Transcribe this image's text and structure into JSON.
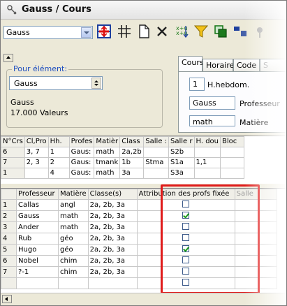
{
  "window": {
    "title": "Gauss / Cours"
  },
  "toolbar": {
    "combo_value": "Gauss",
    "icons": [
      "grid-icon",
      "hash-icon",
      "new-document-icon",
      "delete-icon",
      "sort-icon",
      "filter-icon",
      "copy-icon",
      "layout-icon"
    ]
  },
  "element_panel": {
    "group_label": "Pour élément:",
    "field_value": "Gauss",
    "name_text": "Gauss",
    "value_text": "17.000 Valeurs"
  },
  "tabs": {
    "items": [
      {
        "label": "Cours",
        "active": true
      },
      {
        "label": "Horaire",
        "active": false
      },
      {
        "label": "Code",
        "active": false
      },
      {
        "label": "S",
        "active": false
      }
    ],
    "fields": {
      "hebdo_value": "1",
      "hebdo_label": "H.hebdom.",
      "prof_value": "Gauss",
      "prof_label": "Professeur",
      "matiere_value": "math",
      "matiere_label": "Matière"
    }
  },
  "courses_grid": {
    "headers": [
      "N°Crs",
      "Cl,Pro",
      "Hh.",
      "Profes",
      "Matièr",
      "Class",
      "Salle :",
      "Salle r",
      "H. dou",
      "Bloc"
    ],
    "rows": [
      [
        "6",
        "3, 7",
        "1",
        "Gaus:",
        "math",
        "2a,2b",
        "",
        "S2b",
        "",
        ""
      ],
      [
        "7",
        "2, 3",
        "2",
        "Gaus:",
        "tmank",
        "1b",
        "Stma",
        "S1a",
        "1,1",
        ""
      ],
      [
        "1",
        "",
        "4",
        "Gaus:",
        "math",
        "3a",
        "",
        "S3a",
        "",
        ""
      ]
    ]
  },
  "assignment_grid": {
    "headers": [
      "",
      "Professeur",
      "Matière",
      "Classe(s)",
      "Attribution des profs fixée",
      "Salle"
    ],
    "rows": [
      {
        "num": "1",
        "prof": "Callas",
        "matiere": "angl",
        "classes": "2a, 2b, 3a",
        "fixed": false
      },
      {
        "num": "2",
        "prof": "Gauss",
        "matiere": "math",
        "classes": "2a, 2b, 3a",
        "fixed": true
      },
      {
        "num": "3",
        "prof": "Ander",
        "matiere": "math",
        "classes": "2a, 2b, 3a",
        "fixed": false
      },
      {
        "num": "4",
        "prof": "Rub",
        "matiere": "géo",
        "classes": "2a, 2b, 3a",
        "fixed": false
      },
      {
        "num": "5",
        "prof": "Hugo",
        "matiere": "géo",
        "classes": "2a, 2b, 3a",
        "fixed": true
      },
      {
        "num": "6",
        "prof": "Nobel",
        "matiere": "chim",
        "classes": "2a, 2b, 3a",
        "fixed": false
      },
      {
        "num": "7",
        "prof": "?-1",
        "matiere": "chim",
        "classes": "2a, 2b, 3a",
        "fixed": false
      },
      {
        "num": "",
        "prof": "",
        "matiere": "",
        "classes": "",
        "fixed": false
      }
    ]
  },
  "colors": {
    "highlight": "#e01b1b",
    "check": "#1a9a1a",
    "group_label": "#1e4ebf"
  }
}
